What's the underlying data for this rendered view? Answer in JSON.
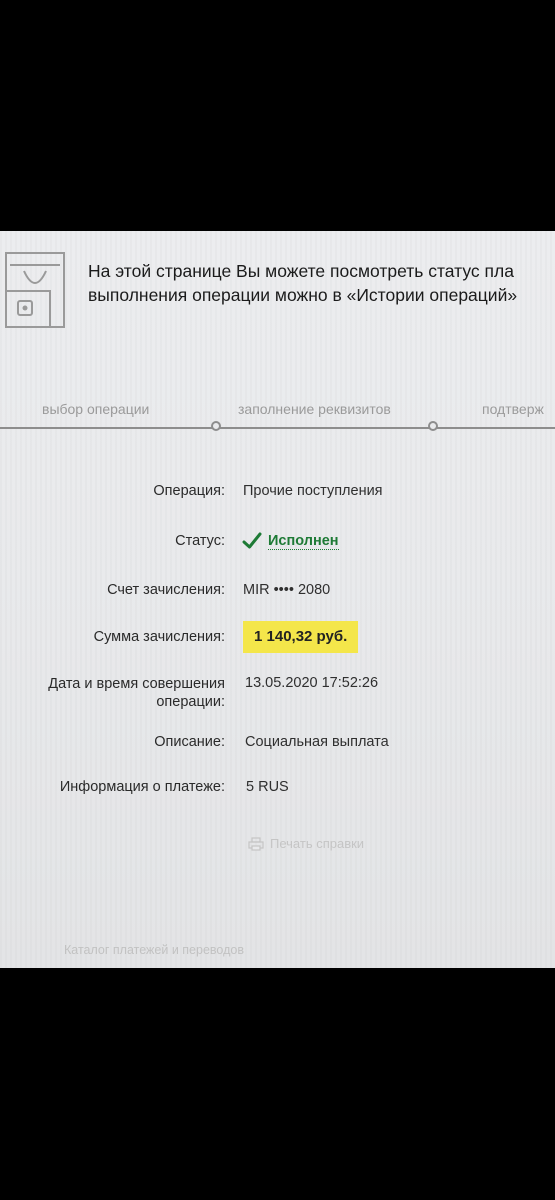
{
  "notice": {
    "line1": "На этой странице Вы можете посмотреть статус пла",
    "line2": "выполнения операции можно в «Истории операций»"
  },
  "steps": {
    "items": [
      "выбор операции",
      "заполнение реквизитов",
      "подтверж"
    ]
  },
  "details": {
    "operation": {
      "label": "Операция:",
      "value": "Прочие поступления"
    },
    "status": {
      "label": "Статус:",
      "value": "Исполнен"
    },
    "account": {
      "label": "Счет зачисления:",
      "value": "MIR •••• 2080"
    },
    "amount": {
      "label": "Сумма зачисления:",
      "value": "1 140,32 руб."
    },
    "datetime": {
      "label_line1": "Дата и время совершения",
      "label_line2": "операции:",
      "value": "13.05.2020 17:52:26"
    },
    "description": {
      "label": "Описание:",
      "value": "Социальная выплата"
    },
    "payment_info": {
      "label": "Информация о платеже:",
      "value": "5 RUS"
    }
  },
  "actions": {
    "print_label": "Печать справки"
  },
  "footer": {
    "catalog_link": "Каталог платежей и переводов"
  },
  "colors": {
    "status_green": "#1d7a35",
    "amount_highlight": "#f4e64a"
  }
}
